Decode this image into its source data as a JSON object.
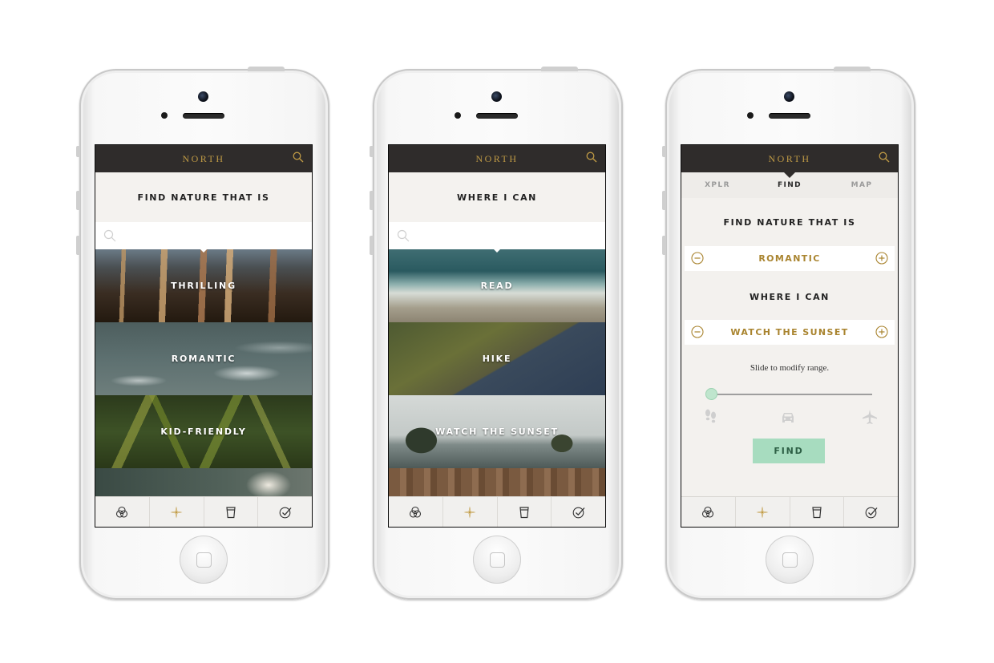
{
  "app": {
    "brand": "NORTH"
  },
  "screens": [
    {
      "prompt": "FIND NATURE THAT IS",
      "tiles": [
        {
          "label": "THRILLING",
          "scene": "wooden-branches"
        },
        {
          "label": "ROMANTIC",
          "scene": "foam-water"
        },
        {
          "label": "KID-FRIENDLY",
          "scene": "mossy-forest"
        },
        {
          "label": "",
          "scene": "white-flowers"
        }
      ]
    },
    {
      "prompt": "WHERE I CAN",
      "tiles": [
        {
          "label": "READ",
          "scene": "ocean-wave"
        },
        {
          "label": "HIKE",
          "scene": "mountain-slope"
        },
        {
          "label": "WATCH THE SUNSET",
          "scene": "sea-stacks"
        },
        {
          "label": "",
          "scene": "wood-planks"
        }
      ]
    },
    {
      "segments": [
        {
          "label": "XPLR",
          "active": false
        },
        {
          "label": "FIND",
          "active": true
        },
        {
          "label": "MAP",
          "active": false
        }
      ],
      "label_1": "FIND NATURE THAT IS",
      "select_1": "ROMANTIC",
      "label_2": "WHERE I CAN",
      "select_2": "WATCH THE SUNSET",
      "hint": "Slide to modify range.",
      "range": {
        "level": 0,
        "modes": [
          "walk-icon",
          "car-icon",
          "plane-icon"
        ]
      },
      "find_label": "FIND"
    }
  ],
  "tabbar": [
    "filter-circles-icon",
    "compass-icon",
    "cup-icon",
    "check-circle-icon"
  ],
  "colors": {
    "header": "#2f2c2b",
    "gold": "#bf9a45",
    "mint": "#a7dcbf",
    "bg": "#f3f1ee"
  }
}
